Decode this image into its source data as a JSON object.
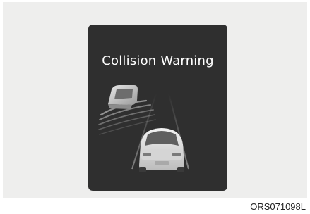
{
  "display": {
    "title": "Collision Warning",
    "icons": [
      "front-vehicle-icon",
      "own-car-icon",
      "lane-lines",
      "warning-wave-icon"
    ]
  },
  "figure": {
    "code": "ORS071098L"
  }
}
